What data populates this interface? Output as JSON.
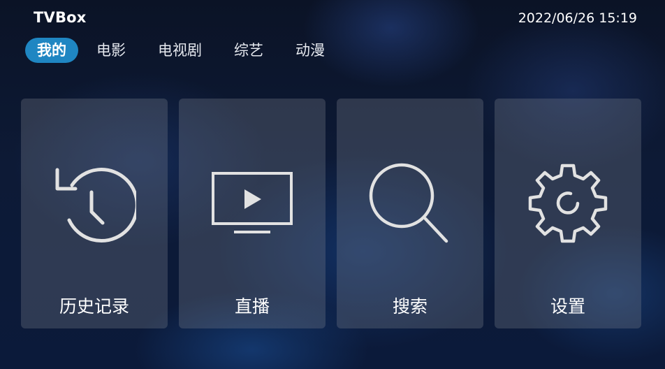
{
  "app": {
    "title": "TVBox",
    "datetime": "2022/06/26 15:19"
  },
  "tabs": [
    {
      "label": "我的",
      "active": true
    },
    {
      "label": "电影",
      "active": false
    },
    {
      "label": "电视剧",
      "active": false
    },
    {
      "label": "综艺",
      "active": false
    },
    {
      "label": "动漫",
      "active": false
    }
  ],
  "cards": [
    {
      "label": "历史记录",
      "icon": "history-clock-icon"
    },
    {
      "label": "直播",
      "icon": "tv-play-icon"
    },
    {
      "label": "搜索",
      "icon": "search-icon"
    },
    {
      "label": "设置",
      "icon": "gear-icon"
    }
  ],
  "colors": {
    "accent": "#1f86c2",
    "text": "#ffffff",
    "card_bg": "rgba(120,128,140,0.32)"
  }
}
